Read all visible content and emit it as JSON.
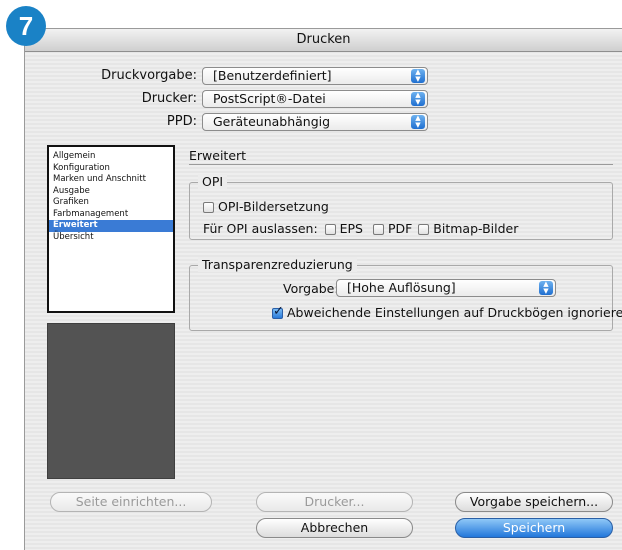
{
  "step_badge": "7",
  "window": {
    "title": "Drucken"
  },
  "form": {
    "preset_label": "Druckvorgabe:",
    "preset_value": "[Benutzerdefiniert]",
    "printer_label": "Drucker:",
    "printer_value": "PostScript®-Datei",
    "ppd_label": "PPD:",
    "ppd_value": "Geräteunabhängig"
  },
  "sidebar": {
    "items": [
      {
        "label": "Allgemein"
      },
      {
        "label": "Konfiguration"
      },
      {
        "label": "Marken und Anschnitt"
      },
      {
        "label": "Ausgabe"
      },
      {
        "label": "Grafiken"
      },
      {
        "label": "Farbmanagement"
      },
      {
        "label": "Erweitert",
        "selected": true
      },
      {
        "label": "Übersicht"
      }
    ]
  },
  "main": {
    "section_title": "Erweitert",
    "opi": {
      "title": "OPI",
      "replace_label": "OPI-Bildersetzung",
      "replace_checked": false,
      "omit_label": "Für OPI auslassen:",
      "eps_label": "EPS",
      "pdf_label": "PDF",
      "bitmap_label": "Bitmap-Bilder"
    },
    "transparency": {
      "title": "Transparenzreduzierung",
      "preset_label": "Vorgabe:",
      "preset_value": "[Hohe Auflösung]",
      "ignore_label": "Abweichende Einstellungen auf Druckbögen ignorieren",
      "ignore_checked": true
    }
  },
  "buttons": {
    "page_setup": "Seite einrichten...",
    "printer": "Drucker...",
    "save_preset": "Vorgabe speichern...",
    "cancel": "Abbrechen",
    "save": "Speichern"
  },
  "colors": {
    "accent": "#1a82c6",
    "selection": "#3a7bd5",
    "default_button": "#2277db"
  }
}
